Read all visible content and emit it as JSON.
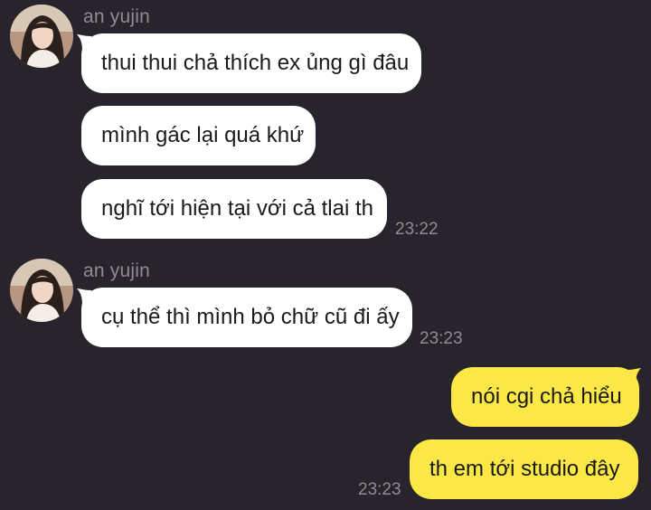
{
  "theme": {
    "background": "#27242b",
    "incoming_bubble": "#ffffff",
    "outgoing_bubble": "#fbe745",
    "meta_text": "#8f8b93"
  },
  "groups": [
    {
      "sender": "an yujin",
      "avatar_icon": "profile-photo",
      "messages": [
        "thui thui chả thích ex ủng gì đâu",
        "mình gác lại quá khứ",
        "nghĩ tới hiện tại với cả tlai th"
      ],
      "time": "23:22"
    },
    {
      "sender": "an yujin",
      "avatar_icon": "profile-photo",
      "messages": [
        "cụ thể thì mình bỏ chữ cũ đi ấy"
      ],
      "time": "23:23"
    }
  ],
  "outgoing": {
    "messages": [
      "nói cgi chả hiểu",
      "th em tới studio đây"
    ],
    "time": "23:23"
  }
}
